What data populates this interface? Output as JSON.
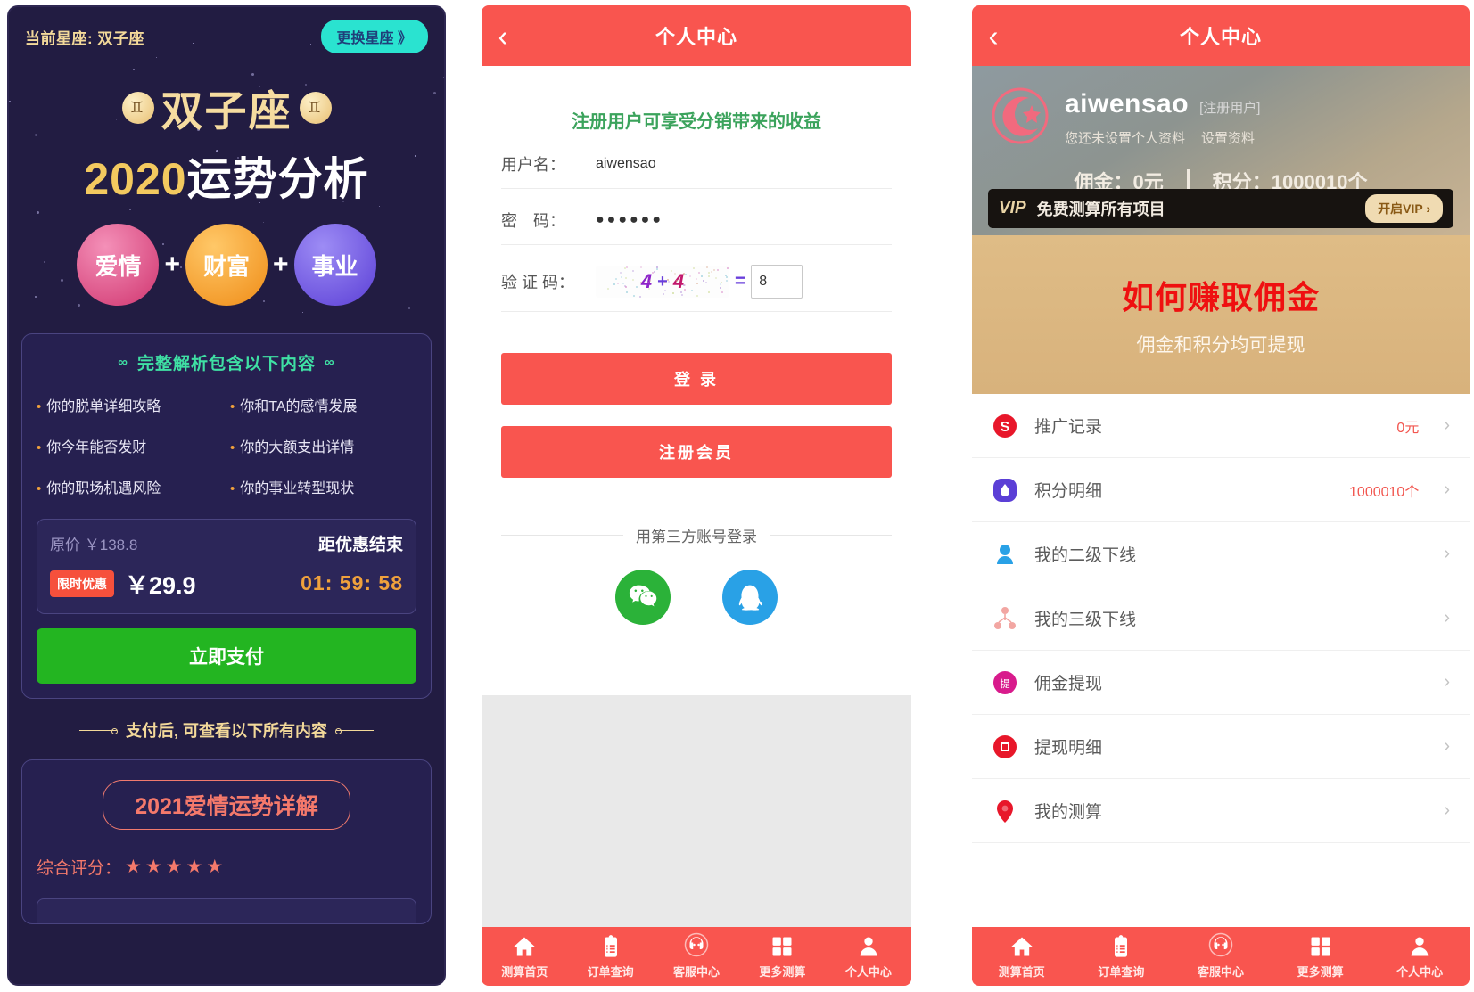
{
  "horoscope": {
    "current_sign_label": "当前星座: 双子座",
    "change_sign_btn": "更换星座 》",
    "sign_name": "双子座",
    "gem_glyph": "♊",
    "year": "2020",
    "year_suffix": "运势分析",
    "orbs": [
      {
        "label": "爱情",
        "color": "#d0356f"
      },
      {
        "label": "财富",
        "color": "#ef8c17"
      },
      {
        "label": "事业",
        "color": "#5b3fd6"
      }
    ],
    "plus": "+",
    "package_header": "完整解析包含以下内容",
    "package_deco": "∞",
    "features": [
      "你的脱单详细攻略",
      "你和TA的感情发展",
      "你今年能否发财",
      "你的大额支出详情",
      "你的职场机遇风险",
      "你的事业转型现状"
    ],
    "feature_dot": "•",
    "original_price_label": "原价",
    "original_price": "￥138.8",
    "timer_label": "距优惠结束",
    "limited_tag": "限时优惠",
    "current_price": "￥29.9",
    "timer_value": "01: 59: 58",
    "pay_button": "立即支付",
    "after_pay_note": "支付后, 可查看以下所有内容",
    "detail_pill": "2021爱情运势详解",
    "score_label": "综合评分：",
    "score_stars": "★★★★★"
  },
  "login": {
    "topbar_title": "个人中心",
    "back_icon": "‹",
    "promo": "注册用户可享受分销带来的收益",
    "fields": [
      {
        "label": "用户名：",
        "value": "aiwensao"
      },
      {
        "label": "密　码：",
        "value": "●●●●●●"
      }
    ],
    "captcha": {
      "label": "验 证 码：",
      "num1": "4",
      "op": "+",
      "num2": "4",
      "equals": "=",
      "answer": "8"
    },
    "login_button": "登 录",
    "register_button": "注册会员",
    "thirdparty_label": "用第三方账号登录",
    "socials": [
      {
        "name": "wechat",
        "color": "#2bb239"
      },
      {
        "name": "qq",
        "color": "#29a1e6"
      }
    ]
  },
  "user_center": {
    "topbar_title": "个人中心",
    "back_icon": "‹",
    "username": "aiwensao",
    "user_tag": "[注册用户]",
    "profile_notice": "您还未设置个人资料",
    "profile_set_link": "设置资料",
    "commission_label": "佣金：0元",
    "points_label": "积分：1000010个",
    "vip_word": "VIP",
    "vip_text": "免费测算所有项目",
    "vip_button": "开启VIP ›",
    "gold_title": "如何赚取佣金",
    "gold_sub": "佣金和积分均可提现",
    "menu": [
      {
        "label": "推广记录",
        "value": "0元",
        "icon": "dollar-coin-icon",
        "color": "#e8172a"
      },
      {
        "label": "积分明细",
        "value": "1000010个",
        "icon": "points-drop-icon",
        "color": "#5b3fd6"
      },
      {
        "label": "我的二级下线",
        "value": "",
        "icon": "person-level2-icon",
        "color": "#29a1e6"
      },
      {
        "label": "我的三级下线",
        "value": "",
        "icon": "person-level3-icon",
        "color": "#f2a6a2"
      },
      {
        "label": "佣金提现",
        "value": "",
        "icon": "withdraw-icon",
        "color": "#d81b8c"
      },
      {
        "label": "提现明细",
        "value": "",
        "icon": "withdraw-detail-icon",
        "color": "#e8172a"
      },
      {
        "label": "我的测算",
        "value": "",
        "icon": "location-pin-icon",
        "color": "#e8172a"
      }
    ],
    "menu_arrow": "›"
  },
  "tabbar": {
    "items": [
      {
        "label": "测算首页",
        "icon": "home-icon"
      },
      {
        "label": "订单查询",
        "icon": "clipboard-icon"
      },
      {
        "label": "客服中心",
        "icon": "support-icon"
      },
      {
        "label": "更多测算",
        "icon": "grid-icon"
      },
      {
        "label": "个人中心",
        "icon": "person-icon"
      }
    ]
  },
  "colors": {
    "brand_red": "#f9554f",
    "night_bg": "#221c42",
    "gold": "#f3d99a",
    "green_pay": "#23b521"
  }
}
